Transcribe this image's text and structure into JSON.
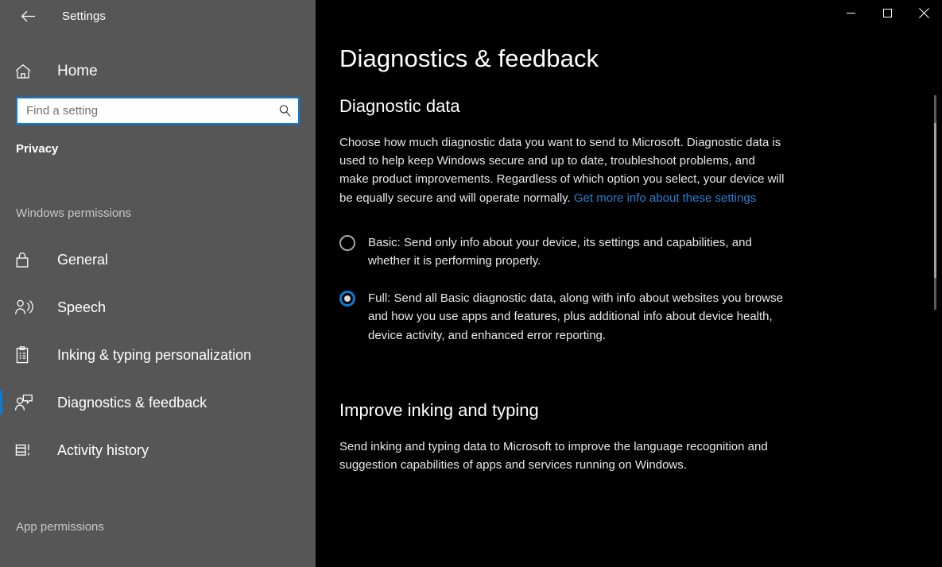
{
  "window": {
    "app_title": "Settings",
    "back_icon": "back-arrow-icon",
    "controls": {
      "minimize": "minimize-icon",
      "maximize": "maximize-icon",
      "close": "close-icon"
    }
  },
  "sidebar": {
    "home": {
      "label": "Home",
      "icon": "home-icon"
    },
    "search": {
      "placeholder": "Find a setting",
      "value": "",
      "icon": "search-icon"
    },
    "category": "Privacy",
    "groups": [
      {
        "heading": "Windows permissions",
        "items": [
          {
            "label": "General",
            "icon": "lock-icon",
            "selected": false
          },
          {
            "label": "Speech",
            "icon": "speech-person-icon",
            "selected": false
          },
          {
            "label": "Inking & typing personalization",
            "icon": "clipboard-icon",
            "selected": false
          },
          {
            "label": "Diagnostics & feedback",
            "icon": "person-feedback-icon",
            "selected": true
          },
          {
            "label": "Activity history",
            "icon": "activity-history-icon",
            "selected": false
          }
        ]
      },
      {
        "heading": "App permissions",
        "items": []
      }
    ]
  },
  "main": {
    "page_title": "Diagnostics & feedback",
    "diagnostic_data": {
      "section_title": "Diagnostic data",
      "description": "Choose how much diagnostic data you want to send to Microsoft. Diagnostic data is used to help keep Windows secure and up to date, troubleshoot problems, and make product improvements. Regardless of which option you select, your device will be equally secure and will operate normally. ",
      "link_text": "Get more info about these settings",
      "options": [
        {
          "label": "Basic: Send only info about your device, its settings and capabilities, and whether it is performing properly.",
          "checked": false
        },
        {
          "label": "Full: Send all Basic diagnostic data, along with info about websites you browse and how you use apps and features, plus additional info about device health, device activity, and enhanced error reporting.",
          "checked": true
        }
      ]
    },
    "improve_inking": {
      "section_title": "Improve inking and typing",
      "description": "Send inking and typing data to Microsoft to improve the language recognition and suggestion capabilities of apps and services running on Windows."
    }
  },
  "colors": {
    "accent": "#0a7cd4",
    "link": "#2a7fd4",
    "sidebar_bg": "#565656",
    "main_bg": "#000000"
  }
}
